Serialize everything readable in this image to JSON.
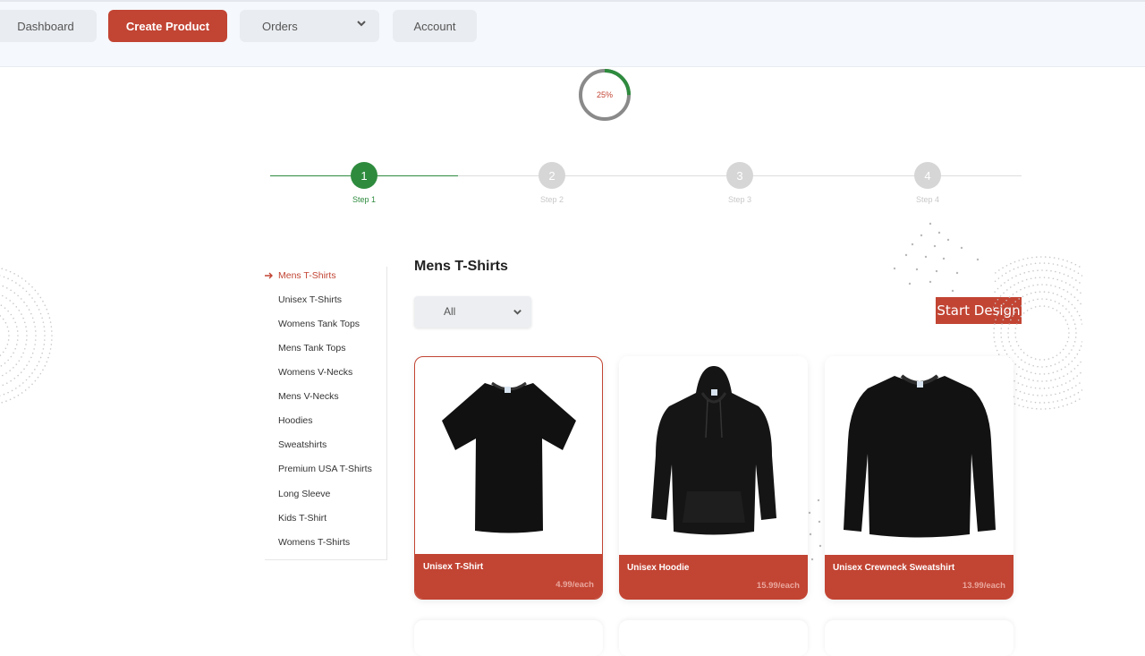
{
  "nav": {
    "dashboard": "Dashboard",
    "create_product": "Create Product",
    "orders": "Orders",
    "account": "Account"
  },
  "progress": {
    "label": "25%",
    "value": 0.25
  },
  "steps": [
    {
      "number": "1",
      "label": "Step 1",
      "active": true
    },
    {
      "number": "2",
      "label": "Step 2",
      "active": false
    },
    {
      "number": "3",
      "label": "Step 3",
      "active": false
    },
    {
      "number": "4",
      "label": "Step 4",
      "active": false
    }
  ],
  "categories": [
    "Mens T-Shirts",
    "Unisex T-Shirts",
    "Womens Tank Tops",
    "Mens Tank Tops",
    "Womens V-Necks",
    "Mens V-Necks",
    "Hoodies",
    "Sweatshirts",
    "Premium USA T-Shirts",
    "Long Sleeve",
    "Kids T-Shirt",
    "Womens T-Shirts"
  ],
  "main": {
    "title": "Mens T-Shirts",
    "filter_value": "All",
    "start_button": "Start Design"
  },
  "products": [
    {
      "name": "Unisex T-Shirt",
      "price": "4.99/each",
      "icon": "tshirt-image"
    },
    {
      "name": "Unisex Hoodie",
      "price": "15.99/each",
      "icon": "hoodie-image"
    },
    {
      "name": "Unisex Crewneck Sweatshirt",
      "price": "13.99/each",
      "icon": "sweatshirt-image"
    }
  ],
  "colors": {
    "accent": "#c24433",
    "success": "#2e8b3e",
    "step_inactive": "#d6d6d6"
  }
}
